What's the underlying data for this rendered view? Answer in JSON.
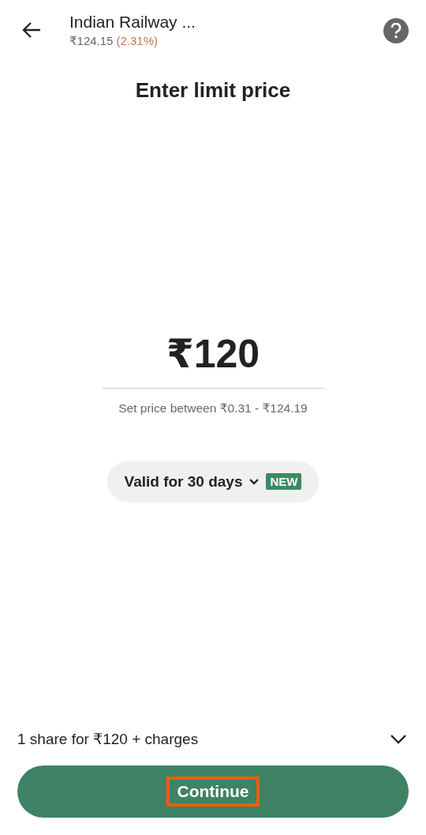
{
  "header": {
    "title": "Indian Railway ...",
    "price": "₹124.15",
    "change": "(2.31%)"
  },
  "heading": "Enter limit price",
  "price_input": {
    "value": "₹120",
    "hint": "Set price between ₹0.31 - ₹124.19"
  },
  "validity": {
    "label": "Valid for 30 days",
    "badge": "NEW"
  },
  "summary": {
    "text": "1 share for ₹120 + charges",
    "expanded": false
  },
  "continue_button": {
    "label": "Continue",
    "highlighted": true
  }
}
